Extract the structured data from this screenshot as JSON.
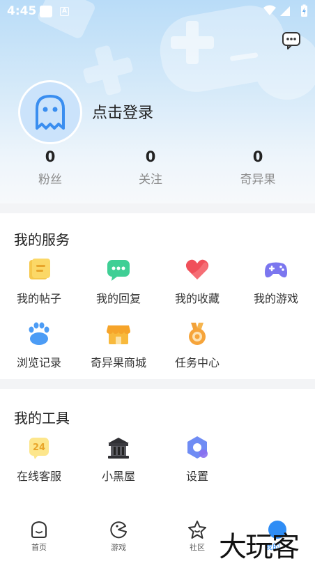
{
  "status_bar": {
    "time": "4:45",
    "a_badge": "A"
  },
  "profile": {
    "login_text": "点击登录"
  },
  "stats": [
    {
      "value": "0",
      "label": "粉丝"
    },
    {
      "value": "0",
      "label": "关注"
    },
    {
      "value": "0",
      "label": "奇异果"
    }
  ],
  "services": {
    "title": "我的服务",
    "items": [
      {
        "label": "我的帖子",
        "icon": "posts-icon"
      },
      {
        "label": "我的回复",
        "icon": "reply-icon"
      },
      {
        "label": "我的收藏",
        "icon": "heart-icon"
      },
      {
        "label": "我的游戏",
        "icon": "gamepad-icon"
      },
      {
        "label": "浏览记录",
        "icon": "paw-icon"
      },
      {
        "label": "奇异果商城",
        "icon": "store-icon"
      },
      {
        "label": "任务中心",
        "icon": "medal-icon"
      }
    ]
  },
  "tools": {
    "title": "我的工具",
    "items": [
      {
        "label": "在线客服",
        "icon": "support-24-icon",
        "badge": "24"
      },
      {
        "label": "小黑屋",
        "icon": "jail-icon"
      },
      {
        "label": "设置",
        "icon": "settings-icon"
      }
    ]
  },
  "tabbar": {
    "items": [
      {
        "label": "首页",
        "icon": "home-icon"
      },
      {
        "label": "游戏",
        "icon": "game-icon"
      },
      {
        "label": "社区",
        "icon": "star-icon"
      },
      {
        "label": "我的",
        "icon": "profile-icon"
      }
    ]
  },
  "watermark": "大玩客"
}
